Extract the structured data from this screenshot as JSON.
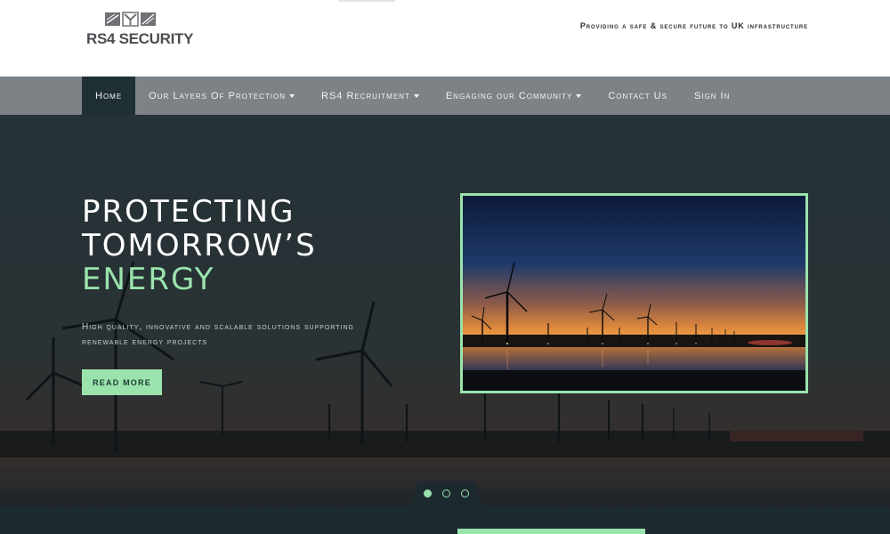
{
  "brand": {
    "logo_text": "RS4 SECURITY",
    "tagline": "Providing a safe & secure future to UK infrastructure"
  },
  "nav": {
    "items": [
      {
        "label": "Home",
        "dropdown": false,
        "active": true
      },
      {
        "label": "Our Layers Of Protection",
        "dropdown": true,
        "active": false
      },
      {
        "label": "RS4 Recruitment",
        "dropdown": true,
        "active": false
      },
      {
        "label": "Engaging our Community",
        "dropdown": true,
        "active": false
      },
      {
        "label": "Contact Us",
        "dropdown": false,
        "active": false
      },
      {
        "label": "Sign In",
        "dropdown": false,
        "active": false
      }
    ]
  },
  "hero": {
    "title_line1": "PROTECTING",
    "title_line2": "TOMORROW’S",
    "title_line3": "ENERGY",
    "subtitle": "High quality, innovative and scalable solutions supporting renewable energy projects",
    "cta_label": "READ MORE"
  },
  "carousel": {
    "slide_count": 3,
    "active_index": 0
  },
  "colors": {
    "accent": "#9ae3ad",
    "nav_bg": "#7c8285",
    "nav_active": "#1f3034",
    "hero_bg": "#1e2a30"
  },
  "icons": {
    "logo": "shield-bars-logo-icon",
    "dropdown": "caret-down-icon"
  }
}
